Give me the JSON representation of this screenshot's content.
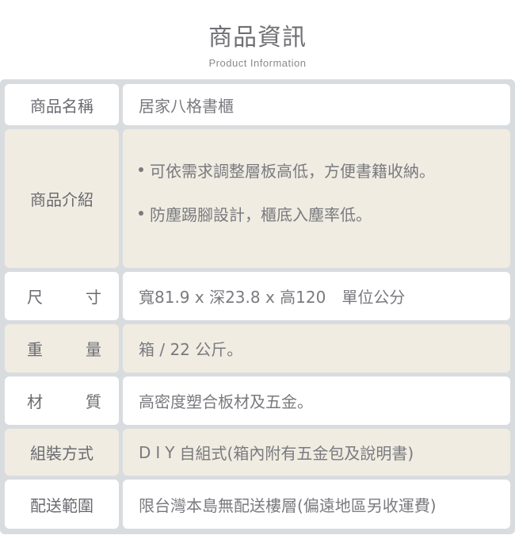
{
  "header": {
    "title": "商品資訊",
    "subtitle": "Product Information"
  },
  "rows": [
    {
      "label": "商品名稱",
      "value": "居家八格書櫃",
      "bg": "white"
    },
    {
      "label": "商品介紹",
      "bullets": [
        "可依需求調整層板高低，方便書籍收納。",
        "防塵踢腳設計，櫃底入塵率低。"
      ],
      "bg": "beige"
    },
    {
      "label_chars": [
        "尺",
        "寸"
      ],
      "value": "寬81.9 x 深23.8 x 高120　單位公分",
      "bg": "white"
    },
    {
      "label_chars": [
        "重",
        "量"
      ],
      "value": "箱 / 22 公斤。",
      "bg": "beige"
    },
    {
      "label_chars": [
        "材",
        "質"
      ],
      "value": "高密度塑合板材及五金。",
      "bg": "white"
    },
    {
      "label": "組裝方式",
      "value_prefix": "DIY",
      "value": "自組式(箱內附有五金包及說明書)",
      "bg": "beige"
    },
    {
      "label": "配送範圍",
      "value": "限台灣本島無配送樓層(偏遠地區另收運費)",
      "bg": "white"
    }
  ],
  "colors": {
    "frame": "#d9dcdf",
    "white_cell": "#ffffff",
    "beige_cell": "#f0ece2",
    "text": "#6b6b70"
  }
}
